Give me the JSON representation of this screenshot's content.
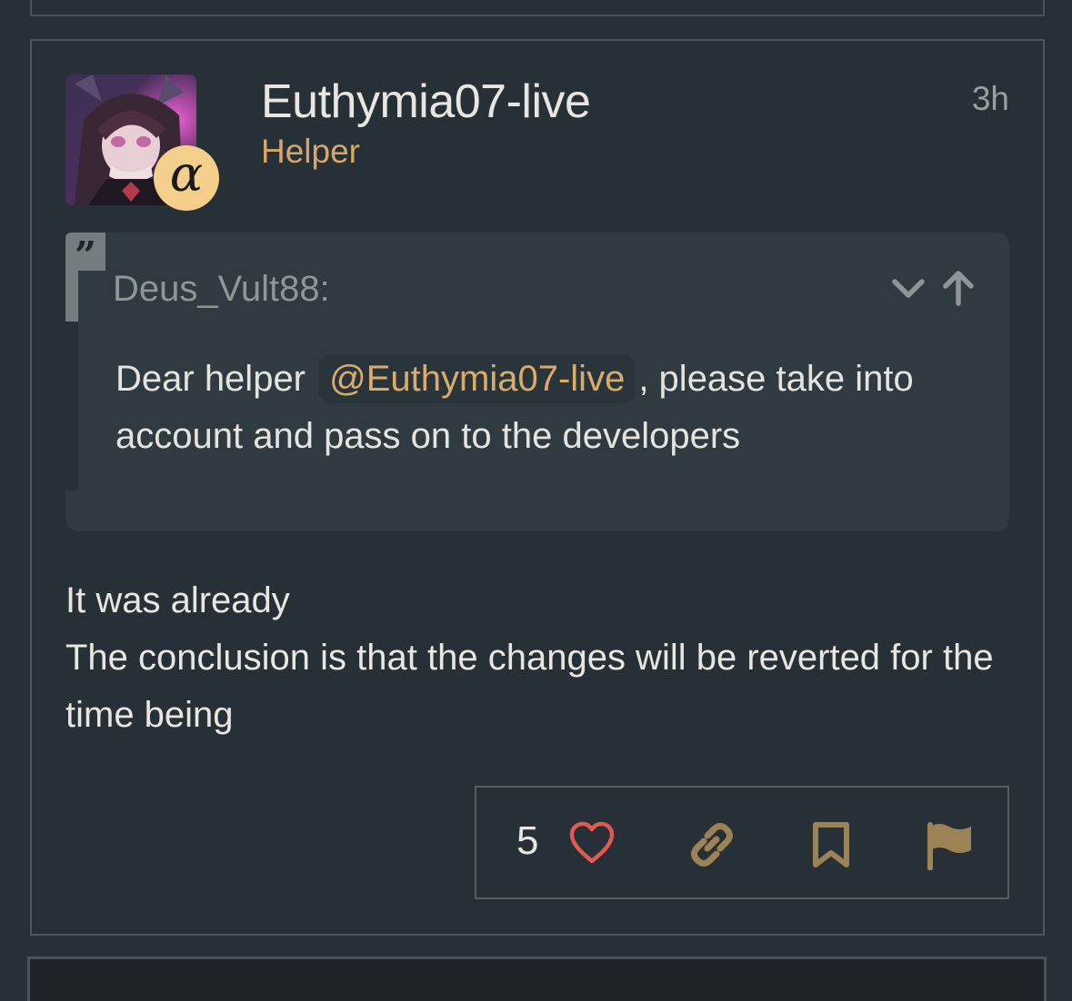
{
  "post": {
    "author": {
      "username": "Euthymia07-live",
      "user_title": "Helper",
      "badge_glyph": "α",
      "badge_color": "#f3cf8b",
      "title_color": "#d5a769"
    },
    "age": "3h",
    "quote": {
      "author": "Deus_Vult88:",
      "text_before": "Dear helper",
      "mention": "@Euthymia07-live",
      "text_after": ", please take into account and pass on to the developers",
      "controls": [
        "chevron-down-icon",
        "arrow-up-icon"
      ]
    },
    "body": {
      "lines": [
        "It was already",
        "The conclusion is that the changes will be reverted for the time being"
      ]
    },
    "actions": {
      "like_count": "5",
      "icons": [
        "heart-icon",
        "link-icon",
        "bookmark-icon",
        "flag-icon"
      ],
      "heart_color": "#e05a4f",
      "icon_color": "#9c8356"
    }
  }
}
